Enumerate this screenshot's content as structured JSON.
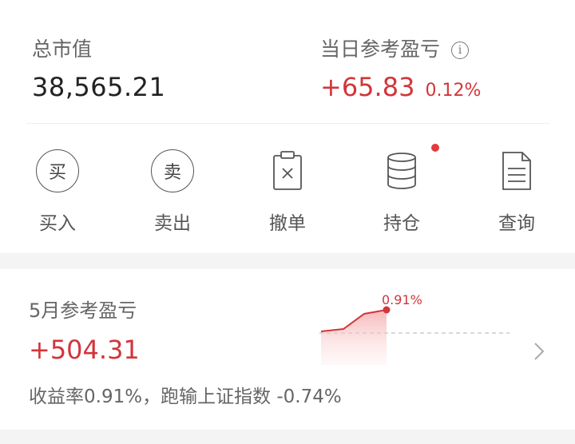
{
  "summary": {
    "total_label": "总市值",
    "total_value": "38,565.21",
    "today_label": "当日参考盈亏",
    "today_value": "+65.83",
    "today_pct": "0.12%"
  },
  "actions": [
    {
      "glyph": "买",
      "label": "买入"
    },
    {
      "glyph": "卖",
      "label": "卖出"
    },
    {
      "label": "撤单"
    },
    {
      "label": "持仓"
    },
    {
      "label": "查询"
    }
  ],
  "monthly": {
    "title": "5月参考盈亏",
    "value": "+504.31",
    "return_text": "收益率0.91%，跑输上证指数 -0.74%",
    "chart_point_label": "0.91%"
  },
  "colors": {
    "accent_red": "#d2353a",
    "text_dark": "#222222",
    "text_grey": "#666666"
  },
  "icons": [
    "info-icon",
    "buy-icon",
    "sell-icon",
    "cancel-order-icon",
    "positions-icon",
    "query-icon",
    "chevron-right-icon"
  ]
}
